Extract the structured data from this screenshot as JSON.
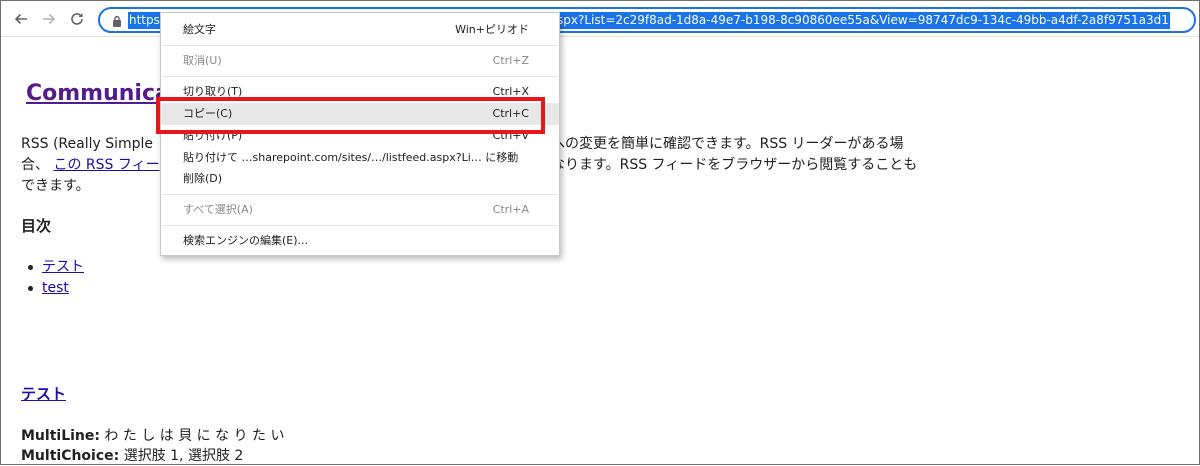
{
  "browser": {
    "url_visible_left": "https:",
    "url_visible_right": "spx?List=2c29f8ad-1d8a-49e7-b198-8c90860ee55a&View=98747dc9-134c-49bb-a4df-2a8f9751a3d1"
  },
  "page": {
    "title": "Communica",
    "para1": {
      "line1_left": "RSS (Really Simple ",
      "line1_right": "への変更を簡単に確認できます。RSS リーダーがある場",
      "line2_prefix": "合、 ",
      "line2_link": "この RSS フィー",
      "line2_right": "なります。RSS フィードをブラウザーから閲覧することも",
      "line3": "できます。"
    },
    "toc_heading": "目次",
    "toc_items": [
      "テスト",
      "test"
    ],
    "section_title": "テスト",
    "fields": [
      {
        "name": "MultiLine:",
        "value": "わ た し は 貝 に な り た い"
      },
      {
        "name": "MultiChoice:",
        "value": "選択肢 1, 選択肢 2"
      }
    ]
  },
  "context_menu": {
    "items": [
      {
        "label": "絵文字",
        "shortcut": "Win+ピリオド"
      },
      {
        "label": "取消(U)",
        "shortcut": "Ctrl+Z"
      },
      {
        "label": "切り取り(T)",
        "shortcut": "Ctrl+X"
      },
      {
        "label": "コピー(C)",
        "shortcut": "Ctrl+C"
      },
      {
        "label": "貼り付け(P)",
        "shortcut": "Ctrl+V"
      },
      {
        "label": "貼り付けて …sharepoint.com/sites/…/listfeed.aspx?Li… に移動",
        "shortcut": ""
      },
      {
        "label": "削除(D)",
        "shortcut": ""
      },
      {
        "label": "すべて選択(A)",
        "shortcut": "Ctrl+A"
      },
      {
        "label": "検索エンジンの編集(E)...",
        "shortcut": ""
      }
    ]
  },
  "colors": {
    "highlight_box": "#e8161a",
    "selection": "#1a73e8",
    "link": "#1a0dab",
    "visited_link": "#551a8b"
  }
}
